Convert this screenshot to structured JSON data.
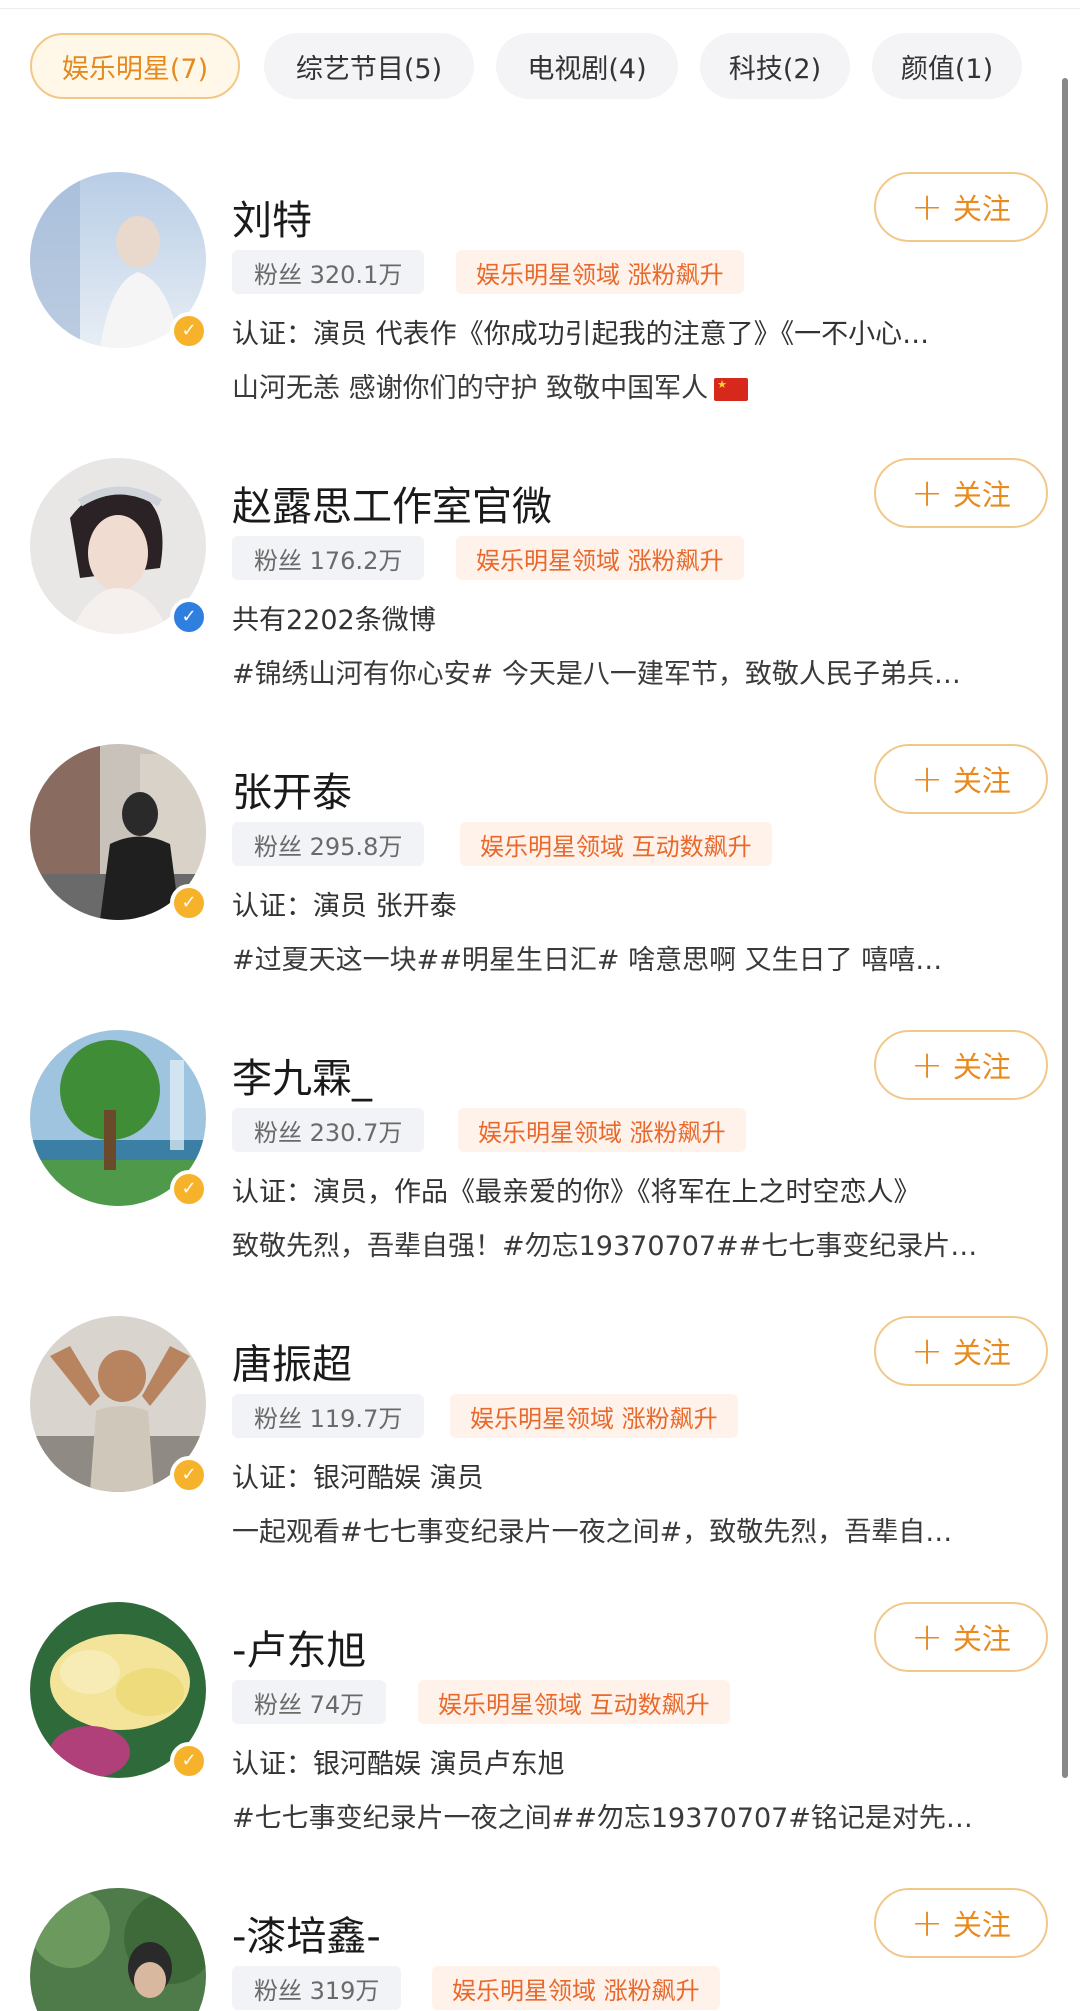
{
  "tabs": [
    {
      "label": "娱乐明星(7)",
      "active": true
    },
    {
      "label": "综艺节目(5)",
      "active": false
    },
    {
      "label": "电视剧(4)",
      "active": false
    },
    {
      "label": "科技(2)",
      "active": false
    },
    {
      "label": "颜值(1)",
      "active": false
    }
  ],
  "follow_label": "关注",
  "users": [
    {
      "name": "刘特",
      "fans": "粉丝 320.1万",
      "tag": "娱乐明星领域 涨粉飙升",
      "line1": "认证：演员 代表作《你成功引起我的注意了》《一不小心…",
      "line2": "山河无恙 感谢你们的守护 致敬中国军人",
      "badge": "gold"
    },
    {
      "name": "赵露思工作室官微",
      "fans": "粉丝 176.2万",
      "tag": "娱乐明星领域 涨粉飙升",
      "line1": "共有2202条微博",
      "line2": "#锦绣山河有你心安# 今天是八一建军节，致敬人民子弟兵…",
      "badge": "blue"
    },
    {
      "name": "张开泰",
      "fans": "粉丝 295.8万",
      "tag": "娱乐明星领域 互动数飙升",
      "line1": "认证：演员 张开泰",
      "line2": "#过夏天这一块##明星生日汇# 啥意思啊 又生日了 嘻嘻…",
      "badge": "gold"
    },
    {
      "name": "李九霖_",
      "fans": "粉丝 230.7万",
      "tag": "娱乐明星领域 涨粉飙升",
      "line1": "认证：演员，作品《最亲爱的你》《将军在上之时空恋人》",
      "line2": "致敬先烈，吾辈自强！#勿忘19370707##七七事变纪录片…",
      "badge": "gold"
    },
    {
      "name": "唐振超",
      "fans": "粉丝 119.7万",
      "tag": "娱乐明星领域 涨粉飙升",
      "line1": "认证：银河酷娱 演员",
      "line2": "一起观看#七七事变纪录片一夜之间#，致敬先烈，吾辈自…",
      "badge": "gold"
    },
    {
      "name": "-卢东旭",
      "fans": "粉丝 74万",
      "tag": "娱乐明星领域 互动数飙升",
      "line1": "认证：银河酷娱 演员卢东旭",
      "line2": "#七七事变纪录片一夜之间##勿忘19370707#铭记是对先…",
      "badge": "gold"
    },
    {
      "name": "-漆培鑫-",
      "fans": "粉丝 319万",
      "tag": "娱乐明星领域 涨粉飙升",
      "line1": "",
      "line2": "",
      "badge": "none"
    }
  ]
}
